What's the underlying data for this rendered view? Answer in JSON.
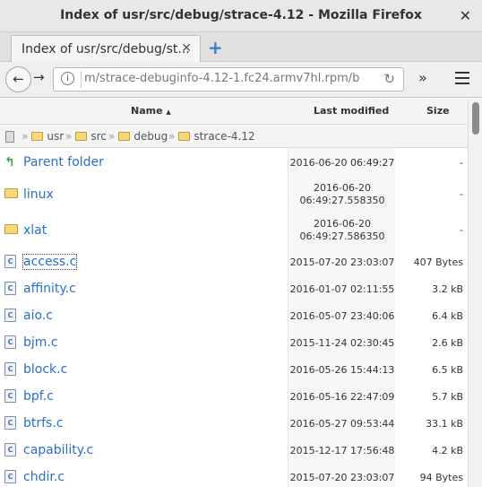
{
  "window": {
    "title": "Index of usr/src/debug/strace-4.12 - Mozilla Firefox"
  },
  "tab": {
    "label": "Index of usr/src/debug/st..."
  },
  "urlbar": {
    "url": "m/strace-debuginfo-4.12-1.fc24.armv7hl.rpm/b"
  },
  "header": {
    "name": "Name",
    "modified": "Last modified",
    "size": "Size",
    "sort_indicator": "▲"
  },
  "breadcrumb": [
    "usr",
    "src",
    "debug",
    "strace-4.12"
  ],
  "icons": {
    "back": "arrow-left-icon",
    "forward": "arrow-right-icon",
    "reload": "reload-icon",
    "info": "info-icon",
    "menu": "hamburger-icon",
    "overflow": "double-chevron-icon"
  },
  "rows": [
    {
      "name": "Parent folder",
      "type": "parent",
      "modified": "2016-06-20 06:49:27",
      "size": "-"
    },
    {
      "name": "linux",
      "type": "folder",
      "modified": "2016-06-20\n06:49:27.558350",
      "size": "-"
    },
    {
      "name": "xlat",
      "type": "folder",
      "modified": "2016-06-20\n06:49:27.586350",
      "size": "-"
    },
    {
      "name": "access.c",
      "type": "file",
      "modified": "2015-07-20 23:03:07",
      "size": "407 Bytes"
    },
    {
      "name": "affinity.c",
      "type": "file",
      "modified": "2016-01-07 02:11:55",
      "size": "3.2 kB"
    },
    {
      "name": "aio.c",
      "type": "file",
      "modified": "2016-05-07 23:40:06",
      "size": "6.4 kB"
    },
    {
      "name": "bjm.c",
      "type": "file",
      "modified": "2015-11-24 02:30:45",
      "size": "2.6 kB"
    },
    {
      "name": "block.c",
      "type": "file",
      "modified": "2016-05-26 15:44:13",
      "size": "6.5 kB"
    },
    {
      "name": "bpf.c",
      "type": "file",
      "modified": "2016-05-16 22:47:09",
      "size": "5.7 kB"
    },
    {
      "name": "btrfs.c",
      "type": "file",
      "modified": "2016-05-27 09:53:44",
      "size": "33.1 kB"
    },
    {
      "name": "capability.c",
      "type": "file",
      "modified": "2015-12-17 17:56:48",
      "size": "4.2 kB"
    },
    {
      "name": "chdir.c",
      "type": "file",
      "modified": "2015-07-20 23:03:07",
      "size": "94 Bytes"
    }
  ]
}
